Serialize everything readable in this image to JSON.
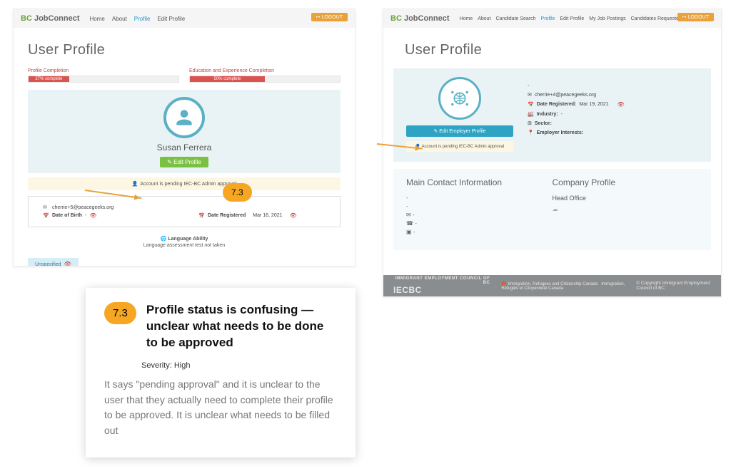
{
  "brand": {
    "bc": "BC",
    "jc": "JobConnect"
  },
  "logout": "LOGOUT",
  "left": {
    "nav": [
      "Home",
      "About",
      "Profile",
      "Edit Profile"
    ],
    "active_nav_index": 2,
    "page_title": "User Profile",
    "progress": [
      {
        "label": "Profile Completion",
        "pct": "27% complete",
        "width": "27%"
      },
      {
        "label": "Education and Experience Completion",
        "pct": "50% complete",
        "width": "50%"
      }
    ],
    "user_name": "Susan Ferrera",
    "edit_profile": "✎ Edit Profile",
    "pending_msg": "Account is pending IEC-BC Admin approval",
    "email": "cherrie+5@peacegeeks.org",
    "dob_label": "Date of Birth",
    "dob_value": "-",
    "reg_label": "Date Registered",
    "reg_value": "Mar 16, 2021",
    "lang_title": "Language Ability",
    "lang_msg": "Language assessment test not taken",
    "unspecified": "Unspecified",
    "badge_num": "7.3"
  },
  "right": {
    "nav": [
      "Home",
      "About",
      "Candidate Search",
      "Profile",
      "Edit Profile",
      "My Job Postings",
      "Candidates Requested"
    ],
    "active_nav_index": 3,
    "page_title": "User Profile",
    "edit_employer": "✎ Edit Employer Profile",
    "pending_msg": "Account is pending IEC-BC Admin approval",
    "company_name": "-",
    "email": "cherrie+4@peacegeeks.org",
    "reg_label": "Date Registered:",
    "reg_value": "Mar 19, 2021",
    "industry_label": "Industry:",
    "industry_value": "-",
    "sector_label": "Sector:",
    "interests_label": "Employer Interests:",
    "contact_title": "Main Contact Information",
    "company_title": "Company Profile",
    "head_office": "Head Office",
    "footer_org": "IMMIGRANT EMPLOYMENT COUNCIL OF BC",
    "footer_iec": "IECBC",
    "footer_copy": "© Copyright Immigrant Employment Council of BC"
  },
  "issue": {
    "num": "7.3",
    "title": "Profile status is confusing — unclear what needs to be done to be approved",
    "severity": "Severity: High",
    "body": "It says \"pending approval\" and it is unclear to the user that they actually need to complete their profile to be approved. It is unclear what needs to be filled out"
  }
}
